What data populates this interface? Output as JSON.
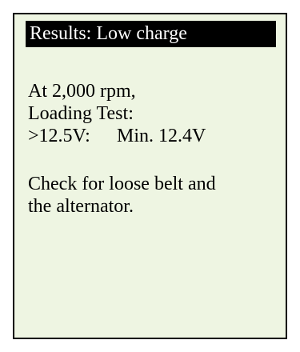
{
  "screen": {
    "title": "Results: Low charge",
    "lines": [
      "At 2,000 rpm,",
      "Loading Test:"
    ],
    "voltage": {
      "left": ">12.5V:",
      "right": "Min. 12.4V"
    },
    "advice": [
      "Check for loose belt and",
      "the alternator."
    ]
  },
  "colors": {
    "screen_background": "#eef5e2",
    "title_background": "#000000",
    "title_text": "#ffffff",
    "text": "#000000"
  }
}
